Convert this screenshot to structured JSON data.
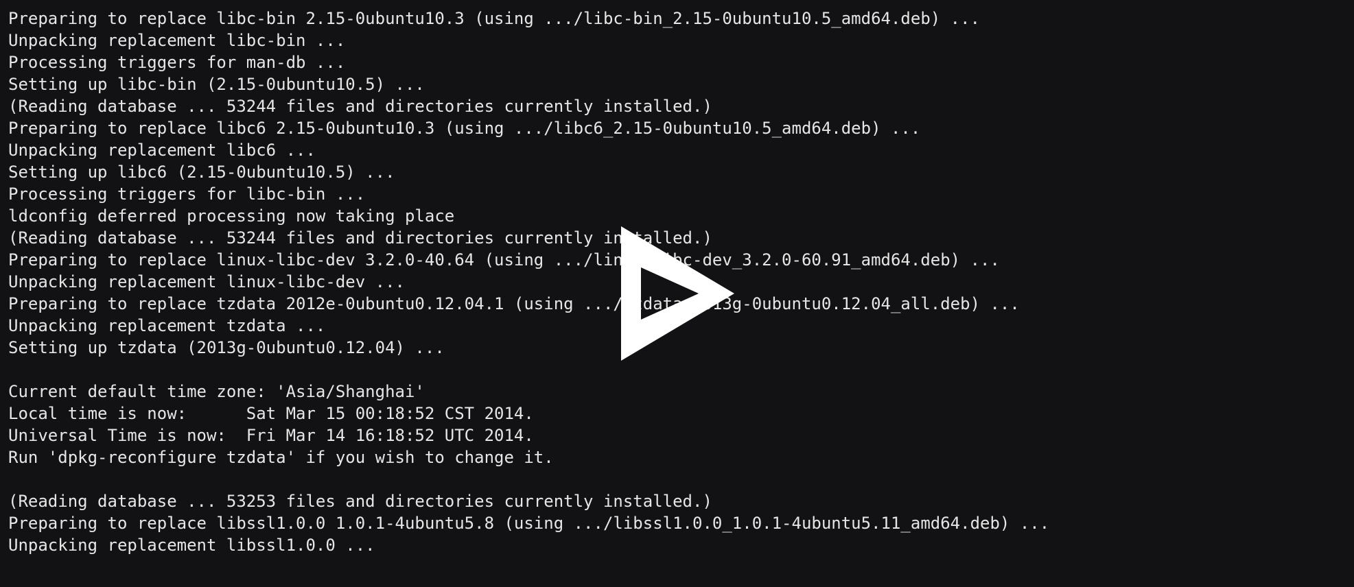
{
  "terminal": {
    "lines": [
      "Preparing to replace libc-bin 2.15-0ubuntu10.3 (using .../libc-bin_2.15-0ubuntu10.5_amd64.deb) ...",
      "Unpacking replacement libc-bin ...",
      "Processing triggers for man-db ...",
      "Setting up libc-bin (2.15-0ubuntu10.5) ...",
      "(Reading database ... 53244 files and directories currently installed.)",
      "Preparing to replace libc6 2.15-0ubuntu10.3 (using .../libc6_2.15-0ubuntu10.5_amd64.deb) ...",
      "Unpacking replacement libc6 ...",
      "Setting up libc6 (2.15-0ubuntu10.5) ...",
      "Processing triggers for libc-bin ...",
      "ldconfig deferred processing now taking place",
      "(Reading database ... 53244 files and directories currently installed.)",
      "Preparing to replace linux-libc-dev 3.2.0-40.64 (using .../linux-libc-dev_3.2.0-60.91_amd64.deb) ...",
      "Unpacking replacement linux-libc-dev ...",
      "Preparing to replace tzdata 2012e-0ubuntu0.12.04.1 (using .../tzdata_2013g-0ubuntu0.12.04_all.deb) ...",
      "Unpacking replacement tzdata ...",
      "Setting up tzdata (2013g-0ubuntu0.12.04) ...",
      "",
      "Current default time zone: 'Asia/Shanghai'",
      "Local time is now:      Sat Mar 15 00:18:52 CST 2014.",
      "Universal Time is now:  Fri Mar 14 16:18:52 UTC 2014.",
      "Run 'dpkg-reconfigure tzdata' if you wish to change it.",
      "",
      "(Reading database ... 53253 files and directories currently installed.)",
      "Preparing to replace libssl1.0.0 1.0.1-4ubuntu5.8 (using .../libssl1.0.0_1.0.1-4ubuntu5.11_amd64.deb) ...",
      "Unpacking replacement libssl1.0.0 ..."
    ]
  },
  "overlay": {
    "icon": "play-icon",
    "color": "#ffffff"
  },
  "colors": {
    "background": "#121214",
    "text": "#e6e6e6"
  }
}
